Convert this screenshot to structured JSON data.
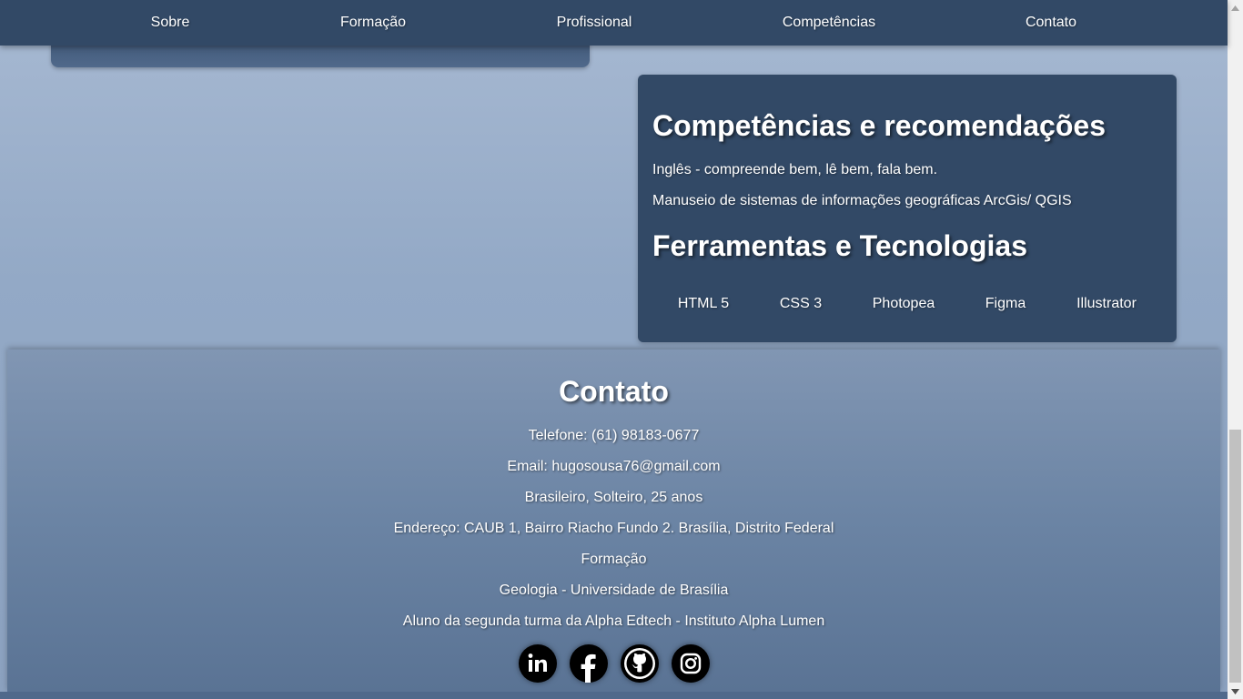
{
  "nav": {
    "items": [
      {
        "label": "Sobre"
      },
      {
        "label": "Formação"
      },
      {
        "label": "Profissional"
      },
      {
        "label": "Competências"
      },
      {
        "label": "Contato"
      }
    ]
  },
  "skills": {
    "title": "Competências e recomendações",
    "lines": [
      "Inglês - compreende bem, lê bem, fala bem.",
      "Manuseio de sistemas de informações geográficas ArcGis/ QGIS"
    ],
    "tools_title": "Ferramentas e Tecnologias",
    "tools": [
      "HTML 5",
      "CSS 3",
      "Photopea",
      "Figma",
      "Illustrator"
    ]
  },
  "contact": {
    "title": "Contato",
    "lines": [
      "Telefone: (61) 98183-0677",
      "Email: hugosousa76@gmail.com",
      "Brasileiro, Solteiro, 25 anos",
      "Endereço: CAUB 1, Bairro Riacho Fundo 2. Brasília, Distrito Federal",
      "Formação",
      "Geologia - Universidade de Brasília",
      "Aluno da segunda turma da Alpha Edtech - Instituto Alpha Lumen"
    ],
    "social": [
      {
        "icon": "linkedin-icon"
      },
      {
        "icon": "facebook-icon"
      },
      {
        "icon": "github-icon"
      },
      {
        "icon": "instagram-icon"
      }
    ]
  },
  "colors": {
    "nav_bg": "#324966",
    "card_bg": "#324966",
    "text": "#ffffff"
  }
}
